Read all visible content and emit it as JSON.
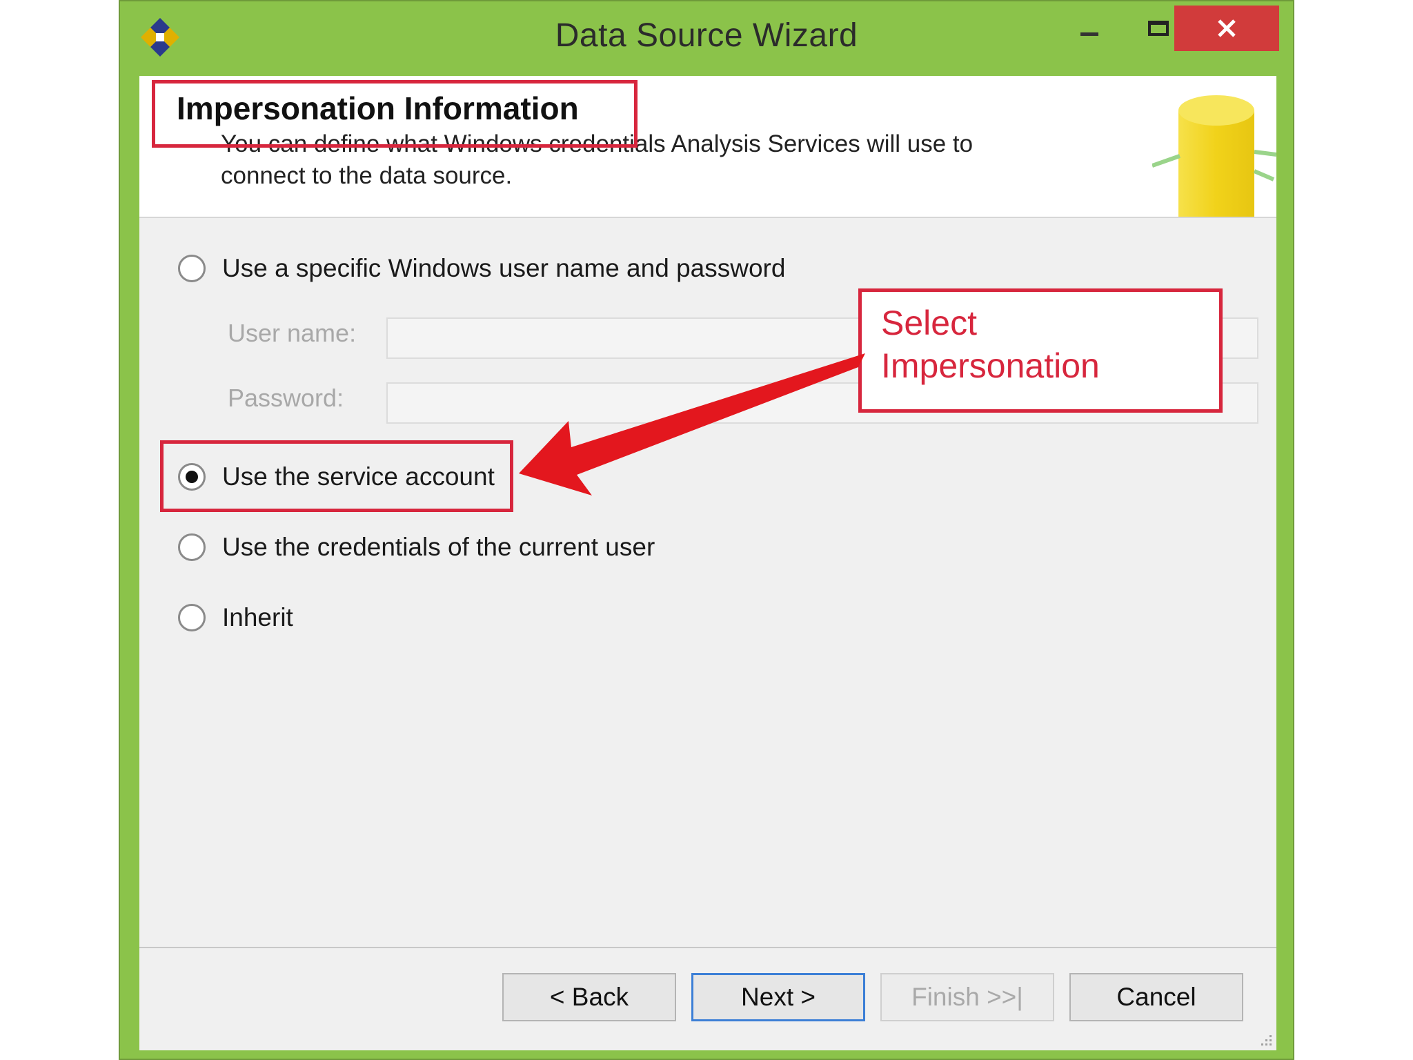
{
  "window": {
    "title": "Data Source Wizard"
  },
  "header": {
    "title": "Impersonation Information",
    "description": "You can define what Windows credentials Analysis Services will use to connect to the data source."
  },
  "options": [
    {
      "label": "Use a specific Windows user name and password",
      "selected": false
    },
    {
      "label": "Use the service account",
      "selected": true
    },
    {
      "label": "Use the credentials of the current user",
      "selected": false
    },
    {
      "label": "Inherit",
      "selected": false
    }
  ],
  "fields": {
    "username_label": "User name:",
    "username_value": "",
    "password_label": "Password:",
    "password_value": ""
  },
  "callout": {
    "text": "Select Impersonation"
  },
  "buttons": {
    "back": "< Back",
    "next": "Next >",
    "finish": "Finish >>|",
    "cancel": "Cancel"
  },
  "colors": {
    "window_frame": "#8bc34a",
    "close_button": "#d13b3b",
    "annotation": "#d7263d",
    "primary_button_border": "#3c7fd6"
  },
  "icons": [
    "wizard-app-icon",
    "minimize-icon",
    "maximize-icon",
    "close-icon",
    "database-icon",
    "resize-grip-icon"
  ]
}
